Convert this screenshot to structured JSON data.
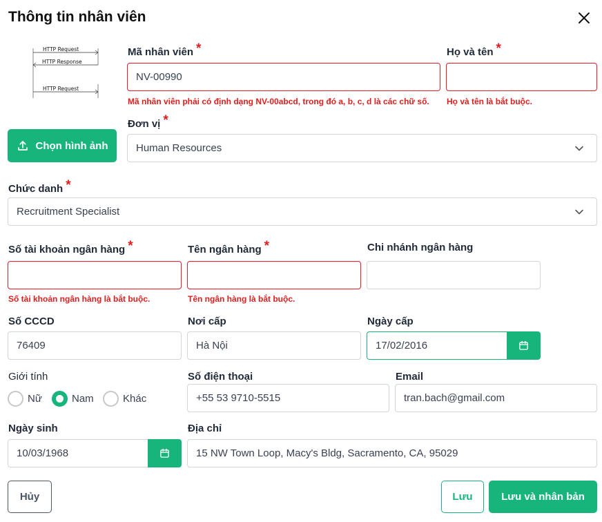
{
  "dialog": {
    "title": "Thông tin nhân viên"
  },
  "image": {
    "diagram_labels": [
      "HTTP Request",
      "HTTP Response",
      "HTTP Request"
    ],
    "upload_label": "Chọn hình ảnh"
  },
  "fields": {
    "employee_code": {
      "label": "Mã nhân viên",
      "value": "NV-00990",
      "error": "Mã nhân viên phải có định dạng NV-00abcd, trong đó a, b, c, d là các chữ số."
    },
    "full_name": {
      "label": "Họ và tên",
      "value": "",
      "error": "Họ và tên là bắt buộc."
    },
    "department": {
      "label": "Đơn vị",
      "value": "Human Resources"
    },
    "position": {
      "label": "Chức danh",
      "value": "Recruitment Specialist"
    },
    "bank_account": {
      "label": "Số tài khoản ngân hàng",
      "value": "",
      "error": "Số tài khoản ngân hàng là bắt buộc."
    },
    "bank_name": {
      "label": "Tên ngân hàng",
      "value": "",
      "error": "Tên ngân hàng là bắt buộc."
    },
    "bank_branch": {
      "label": "Chi nhánh ngân hàng",
      "value": ""
    },
    "id_number": {
      "label": "Số CCCD",
      "value": "76409"
    },
    "issue_place": {
      "label": "Nơi cấp",
      "value": "Hà Nội"
    },
    "issue_date": {
      "label": "Ngày cấp",
      "value": "17/02/2016"
    },
    "gender": {
      "label": "Giới tính",
      "options": [
        "Nữ",
        "Nam",
        "Khác"
      ],
      "selected": "Nam"
    },
    "phone": {
      "label": "Số điện thoại",
      "value": "+55 53 9710-5515"
    },
    "email": {
      "label": "Email",
      "value": "tran.bach@gmail.com"
    },
    "birth_date": {
      "label": "Ngày sinh",
      "value": "10/03/1968"
    },
    "address": {
      "label": "Địa chỉ",
      "value": "15 NW Town Loop, Macy's Bldg, Sacramento, CA, 95029"
    }
  },
  "actions": {
    "cancel": "Hủy",
    "save": "Lưu",
    "save_duplicate": "Lưu và nhân bản"
  },
  "colors": {
    "primary": "#17b57b",
    "error": "#e11d1d"
  }
}
